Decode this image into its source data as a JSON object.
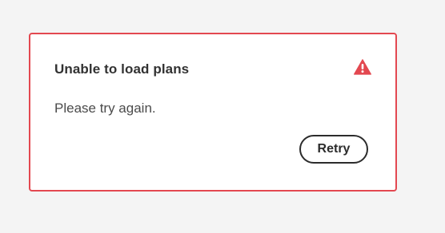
{
  "alert": {
    "title": "Unable to load plans",
    "message": "Please try again.",
    "icon": "alert-triangle-icon",
    "border_color": "#e34850",
    "icon_color": "#e34850"
  },
  "actions": {
    "retry_label": "Retry"
  }
}
